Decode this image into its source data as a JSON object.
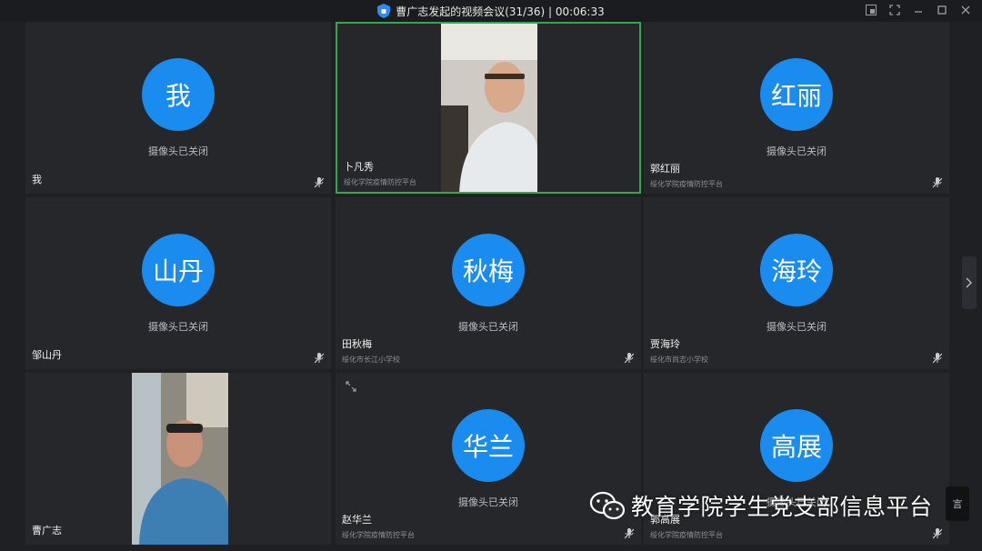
{
  "window": {
    "title": "曹广志发起的视频会议(31/36) | 00:06:33",
    "controls": [
      "pip-icon",
      "fullscreen-icon",
      "minimize-icon",
      "maximize-icon",
      "close-icon"
    ]
  },
  "camera_off_text": "摄像头已关闭",
  "tiles": [
    {
      "avatar": "我",
      "name": "我",
      "org": ""
    },
    {
      "avatar": "",
      "name": "卜凡秀",
      "org": "绥化学院疫情防控平台"
    },
    {
      "avatar": "红丽",
      "name": "郭红丽",
      "org": "绥化学院疫情防控平台"
    },
    {
      "avatar": "山丹",
      "name": "邹山丹",
      "org": ""
    },
    {
      "avatar": "秋梅",
      "name": "田秋梅",
      "org": "绥化市长江小学校"
    },
    {
      "avatar": "海玲",
      "name": "贾海玲",
      "org": "绥化市尚志小学校"
    },
    {
      "avatar": "",
      "name": "曹广志",
      "org": ""
    },
    {
      "avatar": "华兰",
      "name": "赵华兰",
      "org": "绥化学院疫情防控平台"
    },
    {
      "avatar": "高展",
      "name": "郭高展",
      "org": "绥化学院疫情防控平台"
    }
  ],
  "watermark": {
    "text": "教育学院学生党支部信息平台",
    "stub": "言"
  },
  "colors": {
    "avatar": "#1a8cf0",
    "active_border": "#2fa84f",
    "tile_bg": "#25272b",
    "page_bg": "#1e2024"
  }
}
